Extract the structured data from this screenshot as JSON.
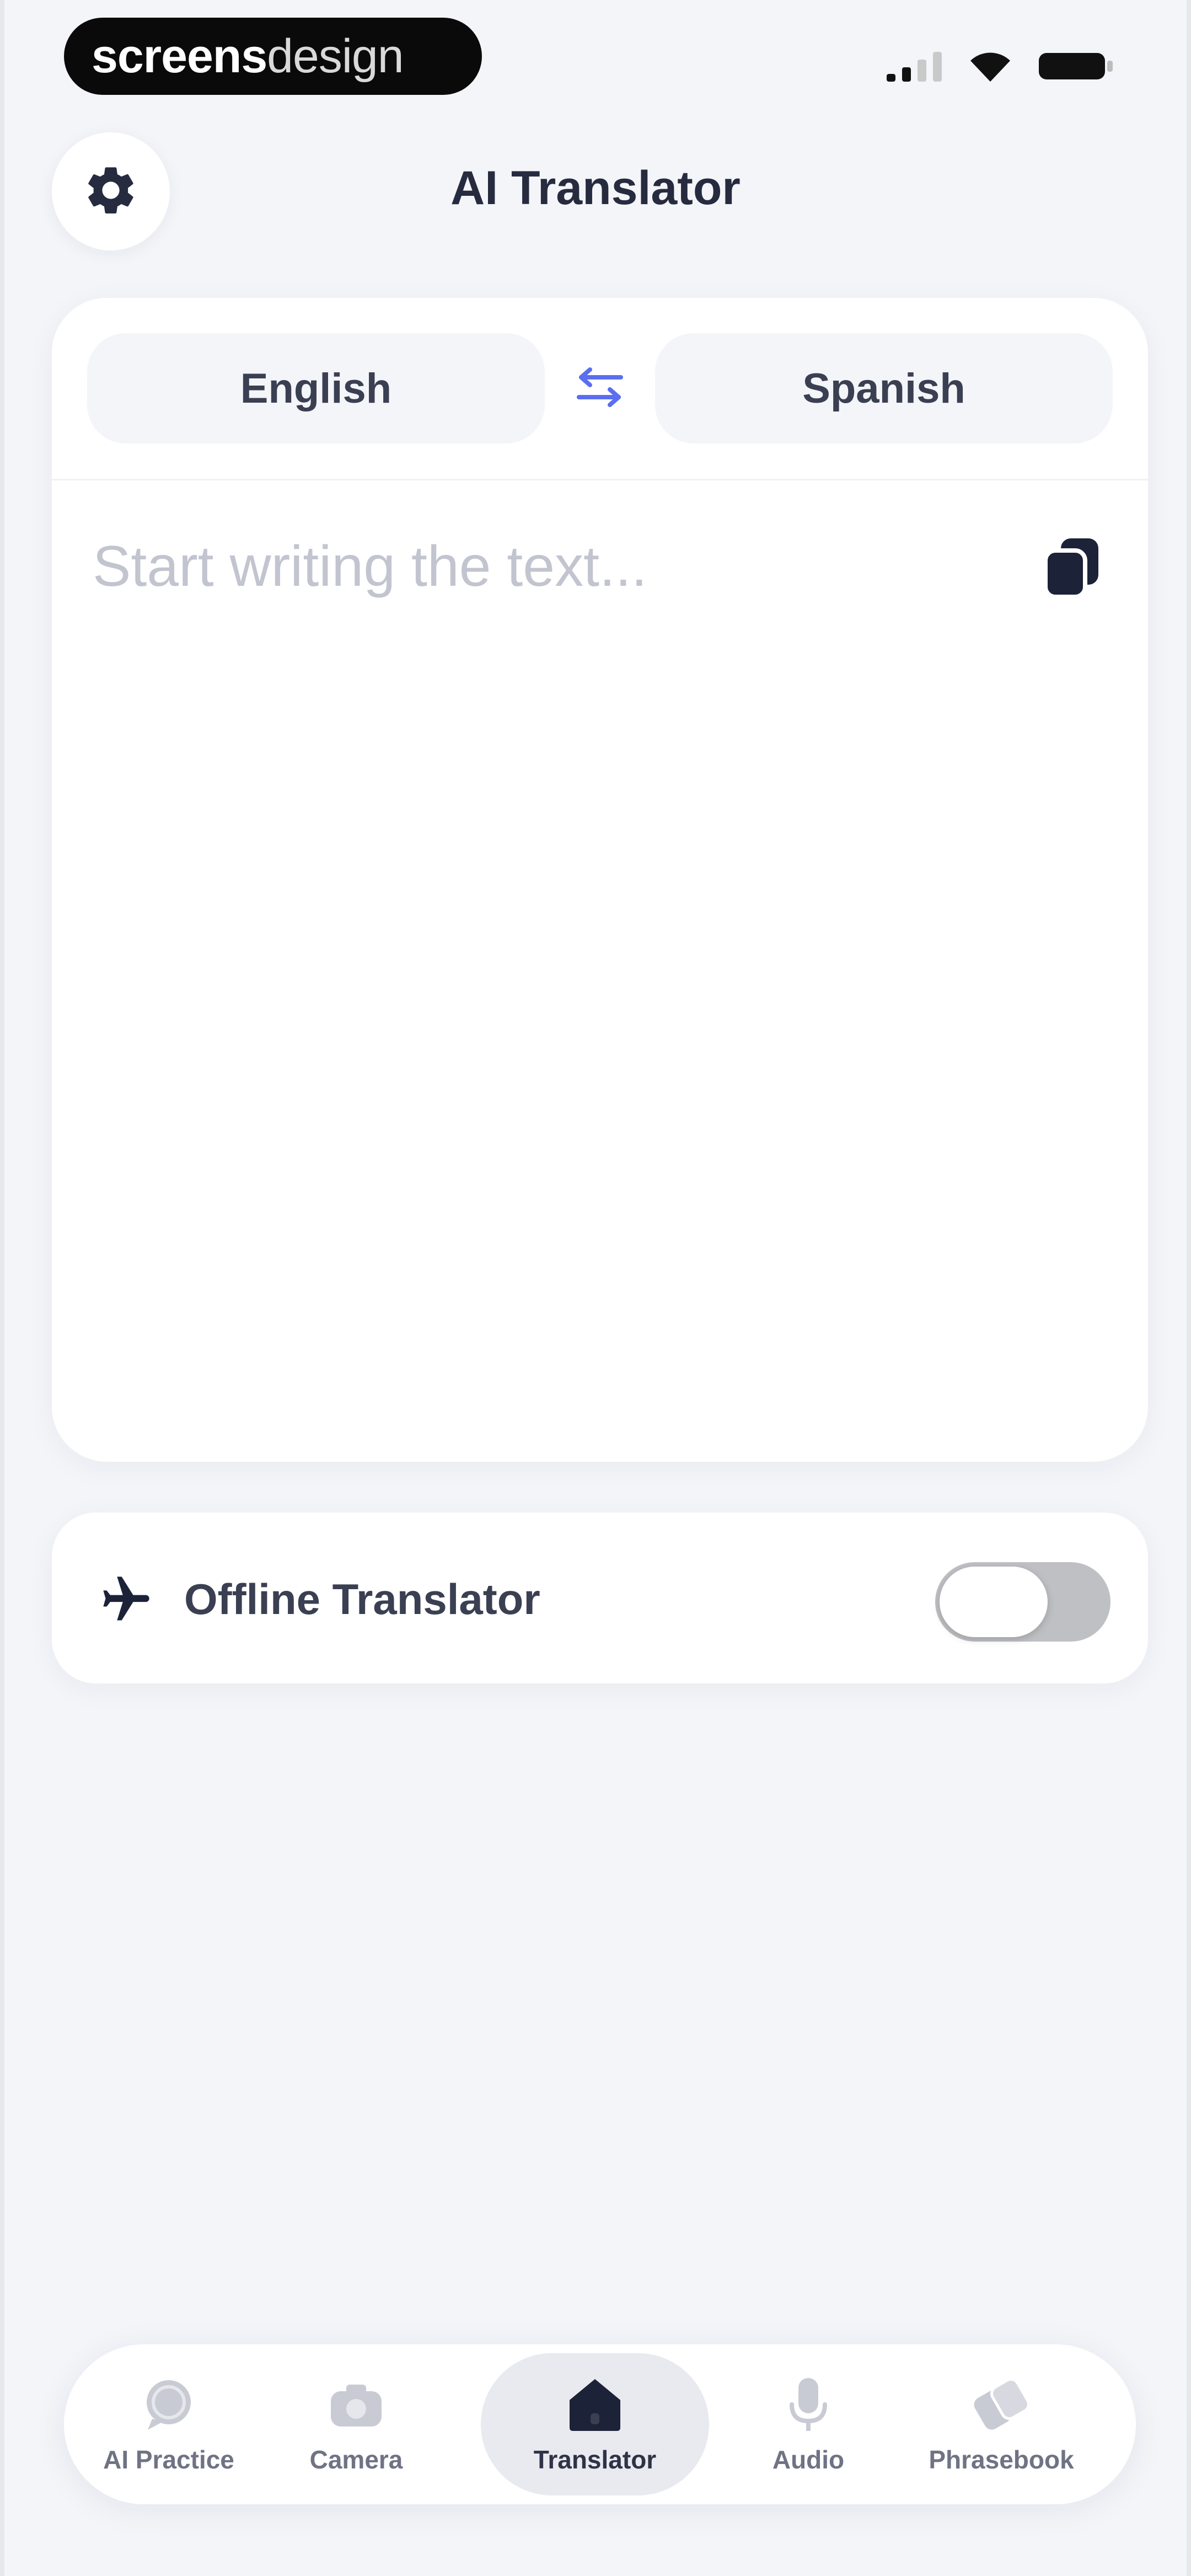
{
  "status_bar": {
    "brand_bold": "screens",
    "brand_light": "design",
    "icons": [
      "signal-icon",
      "wifi-icon",
      "battery-icon"
    ]
  },
  "header": {
    "title": "AI Translator",
    "settings_icon": "gear-icon"
  },
  "translator": {
    "source_language": "English",
    "target_language": "Spanish",
    "swap_icon": "swap-arrows-icon",
    "input_value": "",
    "input_placeholder": "Start writing the text...",
    "paste_icon": "paste-icon"
  },
  "offline": {
    "icon": "airplane-icon",
    "label": "Offline Translator",
    "enabled": false
  },
  "bottom_nav": {
    "items": [
      {
        "label": "AI Practice",
        "icon": "chat-bubble-icon",
        "active": false
      },
      {
        "label": "Camera",
        "icon": "camera-icon",
        "active": false
      },
      {
        "label": "Translator",
        "icon": "home-icon",
        "active": true
      },
      {
        "label": "Audio",
        "icon": "microphone-icon",
        "active": false
      },
      {
        "label": "Phrasebook",
        "icon": "phrasebook-icon",
        "active": false
      }
    ]
  },
  "colors": {
    "background": "#f4f5f9",
    "card": "#ffffff",
    "accent": "#5b6ef0",
    "text_primary": "#262b3f",
    "nav_active": "#1c2237"
  }
}
